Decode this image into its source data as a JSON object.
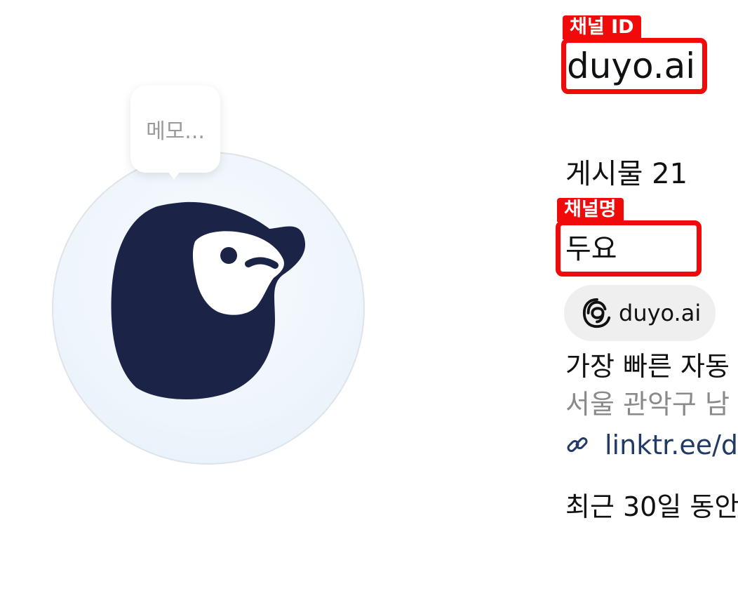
{
  "profile": {
    "memo_placeholder": "메모...",
    "channel_id_tag": "채널 ID",
    "channel_id": "duyo.ai",
    "posts": "게시물 21",
    "channel_name_tag": "채널명",
    "channel_name": "두요",
    "threads_handle": "duyo.ai",
    "bio": "가장 빠른 자동",
    "location": "서울 관악구 남",
    "link": "linktr.ee/d",
    "recent": "최근 30일 동안"
  },
  "icons": {
    "avatar": "duyo-mascot-logo",
    "threads": "threads-icon",
    "link": "link-icon"
  },
  "colors": {
    "highlight": "#f00a0a",
    "mascot": "#1b2447",
    "pill_bg": "#efefef",
    "link": "#223a66",
    "muted": "#8a8a8a"
  }
}
